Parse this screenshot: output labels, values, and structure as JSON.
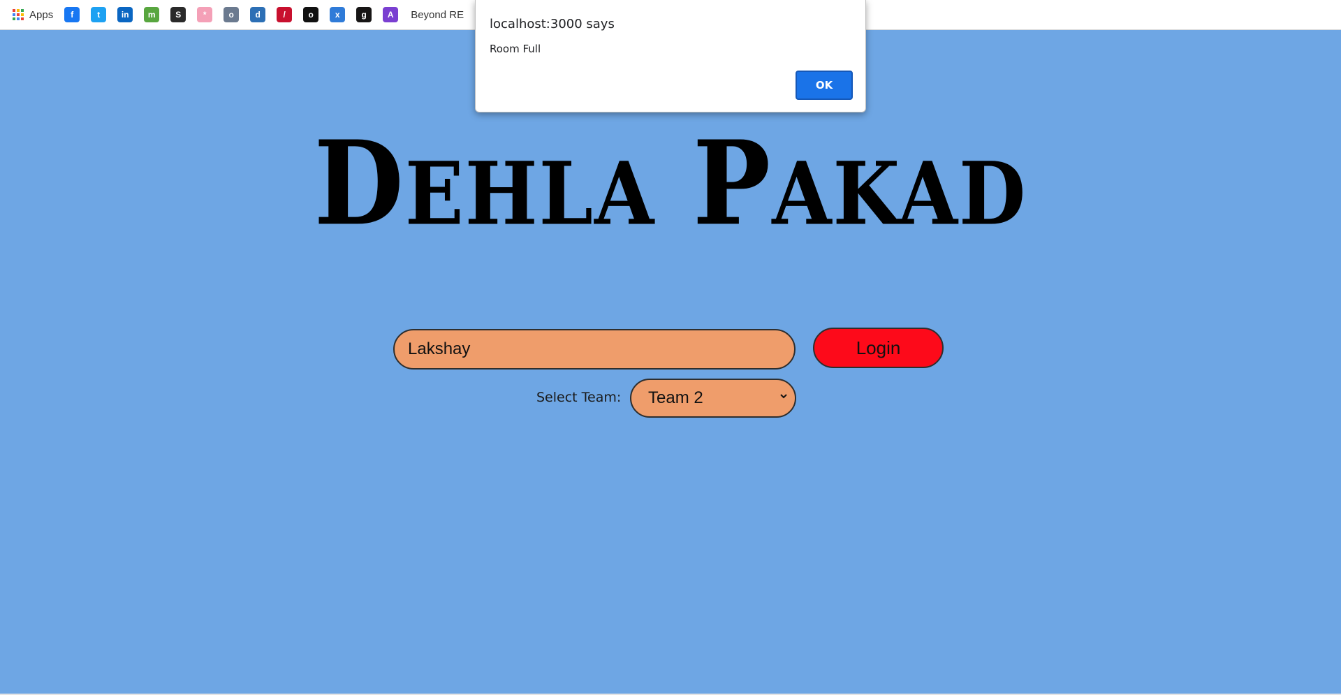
{
  "bookmarks": {
    "apps_label": "Apps",
    "items": [
      {
        "icon": "facebook-icon",
        "glyph": "f",
        "color": "#1877f2"
      },
      {
        "icon": "twitter-icon",
        "glyph": "t",
        "color": "#1da1f2"
      },
      {
        "icon": "linkedin-icon",
        "glyph": "in",
        "color": "#0a66c2"
      },
      {
        "icon": "bookmark-green-icon",
        "glyph": "m",
        "color": "#58a63f"
      },
      {
        "icon": "bookmark-stripes-icon",
        "glyph": "S",
        "color": "#2a2a2a"
      },
      {
        "icon": "bookmark-pink-icon",
        "glyph": "*",
        "color": "#f4a0b7"
      },
      {
        "icon": "bookmark-badge-icon",
        "glyph": "o",
        "color": "#6b7a8f"
      },
      {
        "icon": "dominos-icon",
        "glyph": "d",
        "color": "#2c6fb5"
      },
      {
        "icon": "bookmark-red-icon",
        "glyph": "/",
        "color": "#c8102e"
      },
      {
        "icon": "bookmark-circle-icon",
        "glyph": "o",
        "color": "#111111"
      },
      {
        "icon": "bookmark-blue-icon",
        "glyph": "x",
        "color": "#2f7bd8"
      },
      {
        "icon": "github-icon",
        "glyph": "g",
        "color": "#171515"
      },
      {
        "icon": "bookmark-rocket-icon",
        "glyph": "A",
        "color": "#7a3fd1"
      }
    ],
    "last_label": "Beyond RE"
  },
  "page": {
    "title_first_cap": "D",
    "title_first_rest": "EHLA",
    "title_second_cap": "P",
    "title_second_rest": "AKAD",
    "name_value": "Lakshay",
    "login_label": "Login",
    "team_label": "Select Team:",
    "team_selected": "Team 2"
  },
  "alert": {
    "title": "localhost:3000 says",
    "message": "Room Full",
    "ok_label": "OK"
  },
  "colors": {
    "page_bg": "#6ea6e4",
    "input_bg": "#ef9d6b",
    "login_bg": "#fd0a1a",
    "ok_bg": "#1a73e8"
  }
}
